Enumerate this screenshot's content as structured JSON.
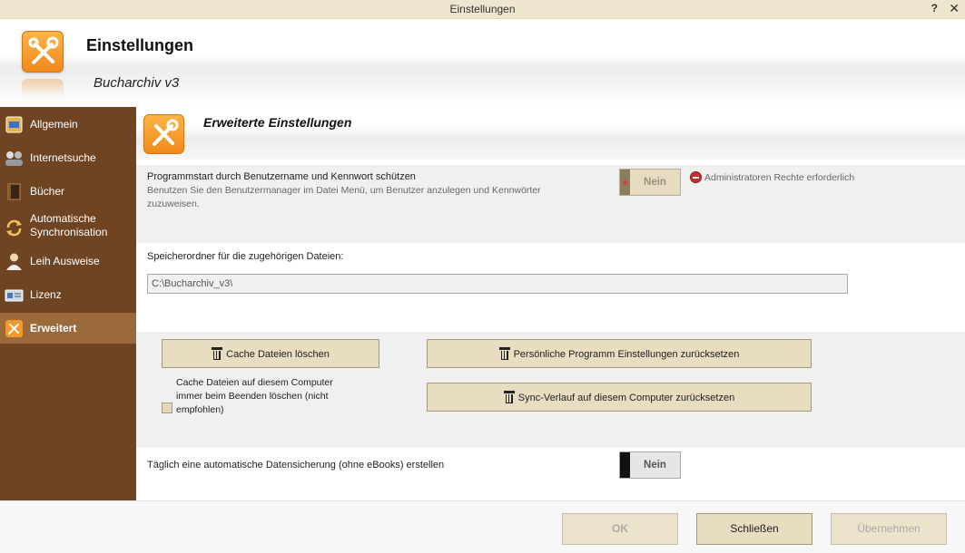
{
  "window": {
    "title": "Einstellungen",
    "help_glyph": "?",
    "close_glyph": "✕"
  },
  "header": {
    "title": "Einstellungen",
    "subtitle": "Bucharchiv v3",
    "icon": "tools-icon"
  },
  "sidebar": {
    "items": [
      {
        "label": "Allgemein",
        "icon": "general-icon"
      },
      {
        "label": "Internetsuche",
        "icon": "web-search-icon"
      },
      {
        "label": "Bücher",
        "icon": "book-icon"
      },
      {
        "label": "Automatische Synchronisation",
        "icon": "sync-icon"
      },
      {
        "label": "Leih Ausweise",
        "icon": "user-icon"
      },
      {
        "label": "Lizenz",
        "icon": "license-icon"
      },
      {
        "label": "Erweitert",
        "icon": "tools-icon",
        "active": true
      }
    ]
  },
  "section": {
    "title": "Erweiterte Einstellungen"
  },
  "protect": {
    "label": "Programmstart durch Benutzername und Kennwort schützen",
    "description": "Benutzen Sie den Benutzermanager im Datei Menü, um Benutzer anzulegen und Kennwörter zuzuweisen.",
    "toggle_value": "Nein",
    "admin_note": "Administratoren Rechte erforderlich"
  },
  "storage": {
    "label": "Speicherordner für die zugehörigen Dateien:",
    "path": "C:\\Bucharchiv_v3\\"
  },
  "cache": {
    "clear_button": "Cache Dateien löschen",
    "checkbox_label": "Cache Dateien auf diesem Computer immer beim Beenden löschen (nicht empfohlen)",
    "checkbox_checked": false,
    "reset_personal_button": "Persönliche Programm Einstellungen zurücksetzen",
    "reset_sync_button": "Sync-Verlauf auf diesem Computer zurücksetzen"
  },
  "backup": {
    "label": "Täglich eine automatische Datensicherung (ohne eBooks) erstellen",
    "toggle_value": "Nein"
  },
  "footer": {
    "ok": "OK",
    "close": "Schließen",
    "apply": "Übernehmen"
  },
  "colors": {
    "sidebar": "#6f4422",
    "sidebar_active": "#9b6a3c",
    "button": "#e8dcc1",
    "accent": "#f08a1c"
  }
}
